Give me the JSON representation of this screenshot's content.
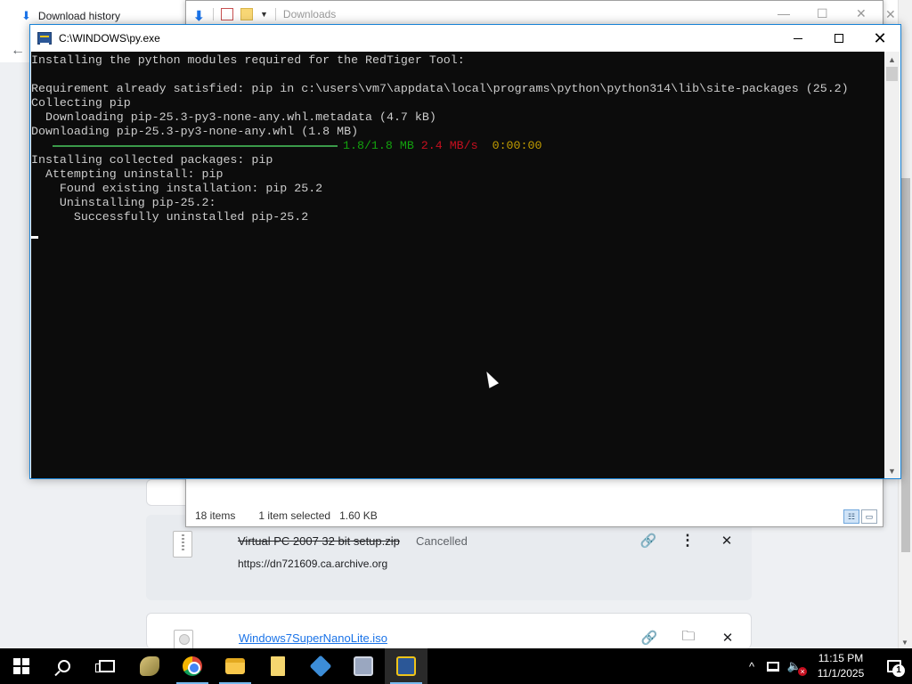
{
  "chrome": {
    "tab_title": "Download history",
    "downloads": [
      {
        "name": "Virtual PC 2007 32 bit setup.zip",
        "status": "Cancelled",
        "url": "https://dn721609.ca.archive.org"
      },
      {
        "name": "Windows7SuperNanoLite.iso"
      }
    ],
    "icons": {
      "tab": "download-icon",
      "back": "back-arrow-icon",
      "copy_link": "link-icon",
      "more": "more-vert-icon",
      "folder": "folder-icon",
      "remove": "close-icon"
    }
  },
  "explorer": {
    "title": "Downloads",
    "status": {
      "item_count": "18 items",
      "selection": "1 item selected",
      "size": "1.60 KB"
    }
  },
  "console": {
    "title": "C:\\WINDOWS\\py.exe",
    "lines": [
      "Installing the python modules required for the RedTiger Tool:",
      "",
      "Requirement already satisfied: pip in c:\\users\\vm7\\appdata\\local\\programs\\python\\python314\\lib\\site-packages (25.2)",
      "Collecting pip",
      "  Downloading pip-25.3-py3-none-any.whl.metadata (4.7 kB)",
      "Downloading pip-25.3-py3-none-any.whl (1.8 MB)"
    ],
    "progress": {
      "fraction": 1.0,
      "size": "1.8/1.8 MB",
      "rate": "2.4 MB/s",
      "eta": "0:00:00"
    },
    "lines_after": [
      "Installing collected packages: pip",
      "  Attempting uninstall: pip",
      "    Found existing installation: pip 25.2",
      "    Uninstalling pip-25.2:",
      "      Successfully uninstalled pip-25.2"
    ]
  },
  "taskbar": {
    "apps": [
      "start",
      "search",
      "task-view",
      "snake-app",
      "chrome",
      "file-explorer",
      "documents",
      "virtualbox",
      "this-pc",
      "python-console"
    ],
    "clock_time": "11:15 PM",
    "clock_date": "11/1/2025",
    "notification_count": "1"
  },
  "colors": {
    "console_bg": "#0c0c0c",
    "console_text": "#cccccc",
    "progress_green": "#13a10e",
    "progress_red": "#c50f1f",
    "progress_yellow": "#c19c00",
    "link_blue": "#1a73e8",
    "taskbar_bg": "#000000"
  }
}
